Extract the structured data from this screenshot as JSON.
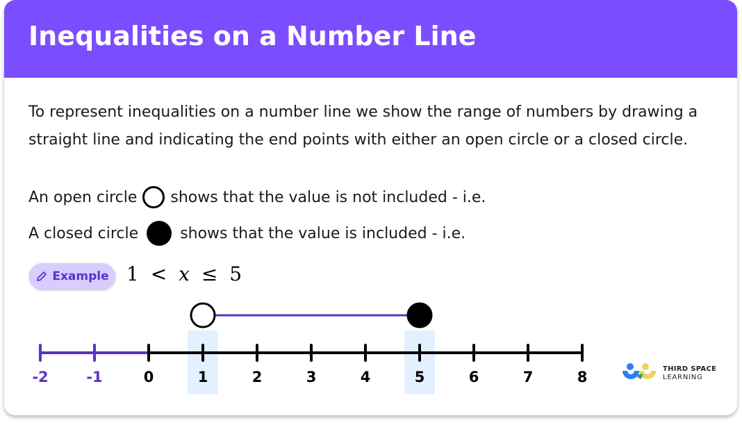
{
  "title": "Inequalities on a Number Line",
  "intro": "To represent inequalities on a number line we show the range of numbers by drawing a straight line and indicating the end points with either an open circle or a closed circle.",
  "open_circle_line": {
    "before": "An open circle",
    "icon": "open-circle-icon",
    "after": "shows that the value is not included - i.e."
  },
  "closed_circle_line": {
    "before": "A closed circle",
    "icon": "closed-circle-icon",
    "after": "shows that the value is included - i.e."
  },
  "example": {
    "label": "Example",
    "icon": "pencil-icon",
    "inequality": {
      "left": "1",
      "op1": "<",
      "var": "x",
      "op2": "≤",
      "right": "5"
    }
  },
  "colors": {
    "header": "#7c4dff",
    "accent_purple": "#5b32c8",
    "pill_bg": "#d9ccff",
    "highlight": "#e3f0ff",
    "axis": "#000000"
  },
  "number_line": {
    "ticks": [
      -2,
      -1,
      0,
      1,
      2,
      3,
      4,
      5,
      6,
      7,
      8
    ],
    "purple_segment": [
      -2,
      0
    ],
    "highlighted": [
      1,
      5
    ],
    "interval": {
      "start": 1,
      "start_type": "open",
      "end": 5,
      "end_type": "closed"
    }
  },
  "logo": {
    "line1": "THIRD SPACE",
    "line2": "LEARNING"
  }
}
